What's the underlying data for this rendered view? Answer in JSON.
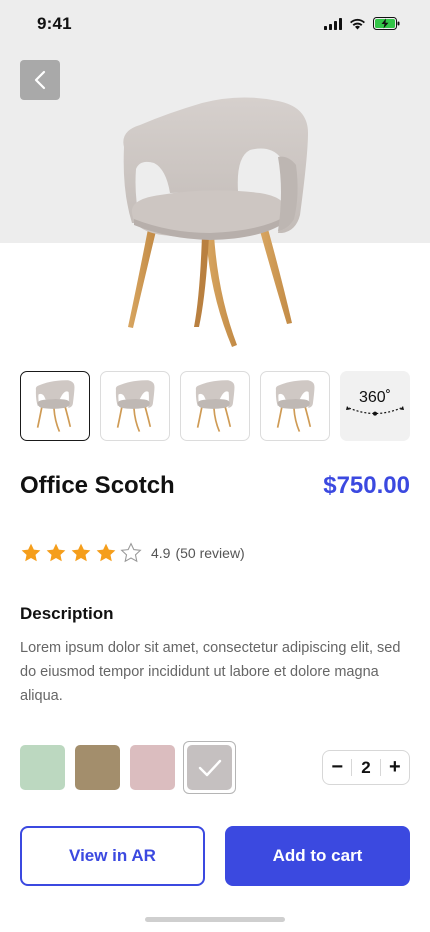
{
  "status_bar": {
    "time": "9:41",
    "icons": [
      "cellular-signal-icon",
      "wifi-icon",
      "battery-charging-icon"
    ]
  },
  "navigation": {
    "back_icon": "chevron-left-icon"
  },
  "product": {
    "name": "Office Scotch",
    "price": "$750.00",
    "rating_value": "4.9",
    "rating_count": "(50 review)",
    "rating_stars": 4,
    "rating_max": 5,
    "description_title": "Description",
    "description": "Lorem ipsum dolor sit amet, consectetur adipiscing elit, sed do eiusmod tempor incididunt ut labore et dolore magna aliqua."
  },
  "gallery": {
    "thumbnails": [
      "chair-thumbnail",
      "chair-thumbnail",
      "chair-thumbnail",
      "chair-thumbnail"
    ],
    "selected_index": 0,
    "view_360_label": "360˚"
  },
  "colors": {
    "swatches": [
      "#bcd8c0",
      "#a38e6c",
      "#dbbdbf",
      "#c5c0c0"
    ],
    "selected_index": 3,
    "accent": "#3b49e0",
    "star": "#f59e1b"
  },
  "quantity": {
    "minus": "−",
    "value": "2",
    "plus": "+"
  },
  "actions": {
    "view_ar": "View in AR",
    "add_to_cart": "Add to cart"
  }
}
